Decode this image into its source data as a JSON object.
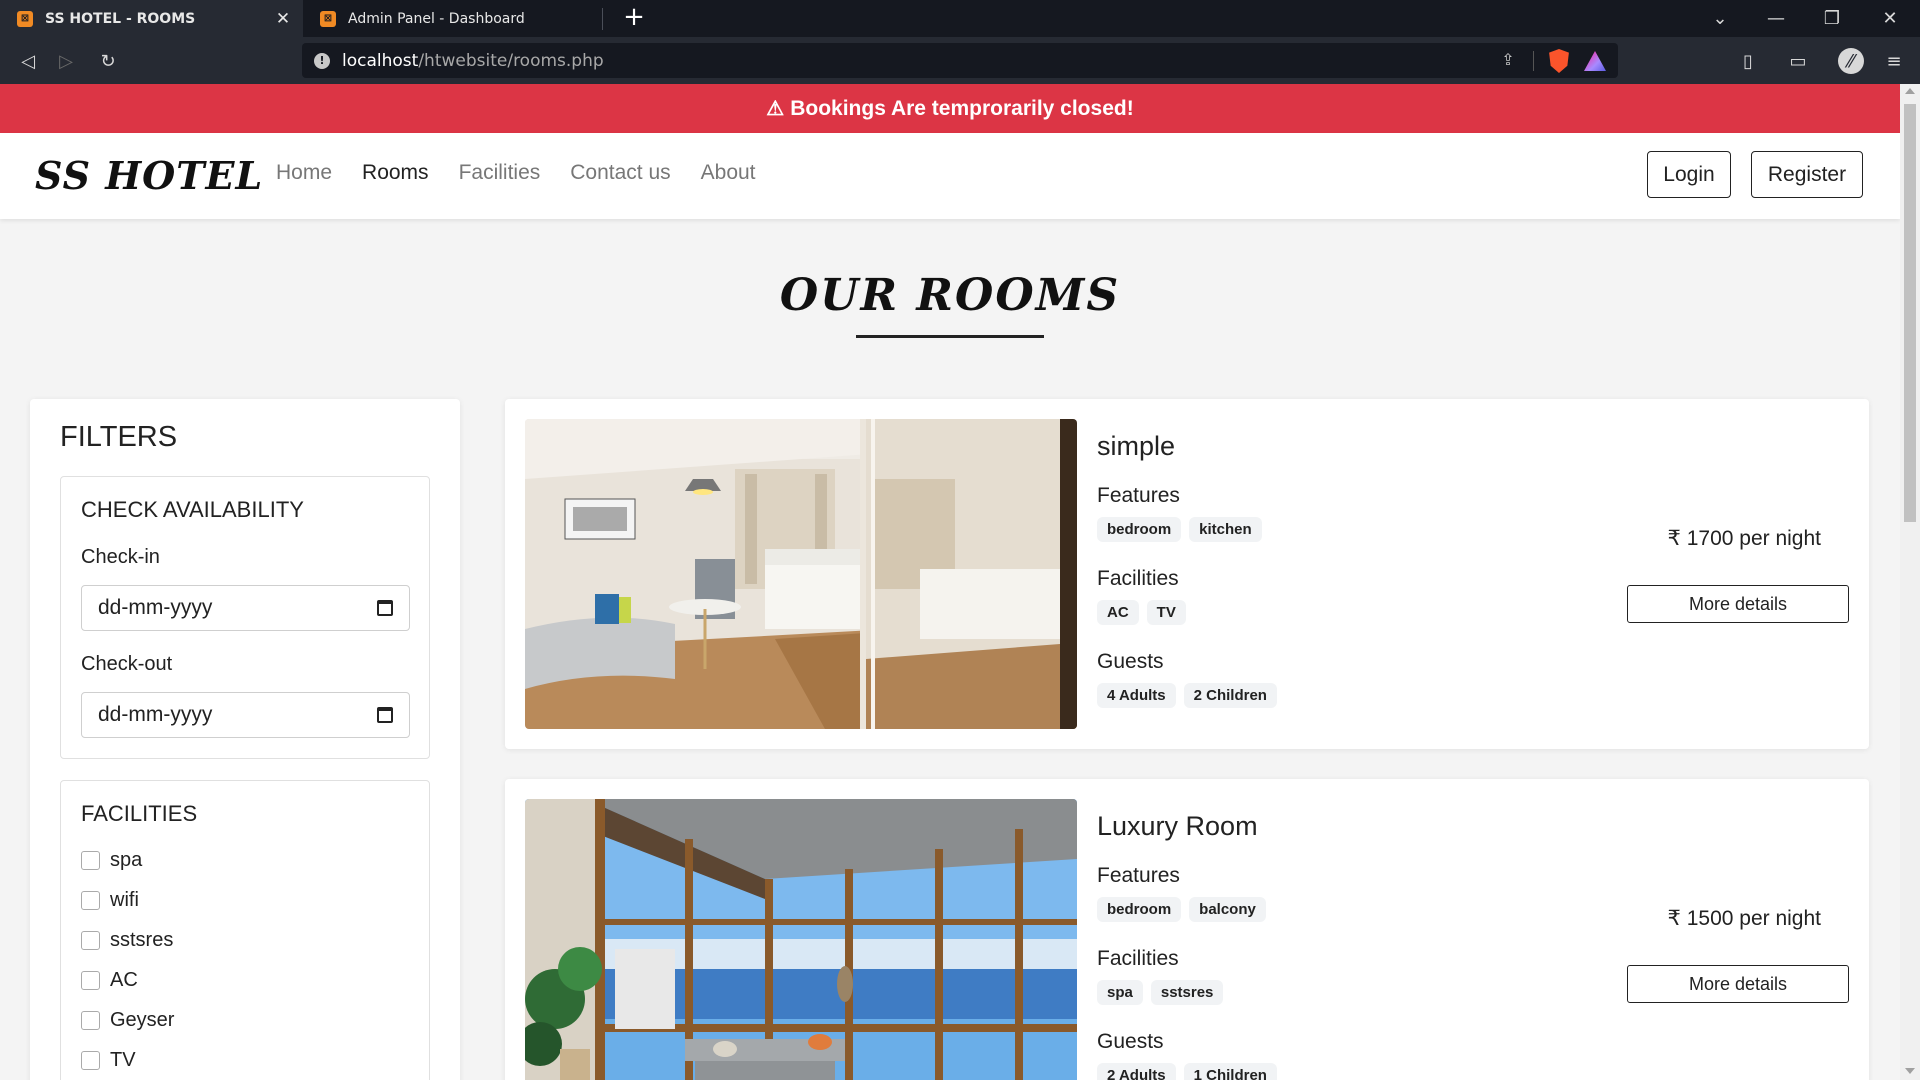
{
  "browser": {
    "tabs": [
      {
        "title": "SS HOTEL - ROOMS",
        "active": true
      },
      {
        "title": "Admin Panel - Dashboard",
        "active": false
      }
    ],
    "url_host": "localhost",
    "url_path": "/htwebsite/rooms.php"
  },
  "alert": {
    "text": "Bookings Are temprorarily closed!"
  },
  "nav": {
    "brand": "SS HOTEL",
    "links": [
      "Home",
      "Rooms",
      "Facilities",
      "Contact us",
      "About"
    ],
    "current": "Rooms",
    "login": "Login",
    "register": "Register"
  },
  "page": {
    "heading": "OUR ROOMS"
  },
  "filters": {
    "title": "FILTERS",
    "availability": {
      "title": "CHECK AVAILABILITY",
      "checkin_label": "Check-in",
      "checkout_label": "Check-out",
      "date_placeholder": "dd-mm-yyyy"
    },
    "facilities": {
      "title": "FACILITIES",
      "options": [
        "spa",
        "wifi",
        "sstsres",
        "AC",
        "Geyser",
        "TV"
      ]
    }
  },
  "rooms": [
    {
      "name": "simple",
      "features_label": "Features",
      "features": [
        "bedroom",
        "kitchen"
      ],
      "facilities_label": "Facilities",
      "facilities": [
        "AC",
        "TV"
      ],
      "guests_label": "Guests",
      "guests": [
        "4 Adults",
        "2 Children"
      ],
      "price": "₹  1700 per night",
      "button": "More details"
    },
    {
      "name": "Luxury Room",
      "features_label": "Features",
      "features": [
        "bedroom",
        "balcony"
      ],
      "facilities_label": "Facilities",
      "facilities": [
        "spa",
        "sstsres"
      ],
      "guests_label": "Guests",
      "guests": [
        "2 Adults",
        "1 Children"
      ],
      "price": "₹  1500 per night",
      "button": "More details"
    }
  ],
  "colors": {
    "alert": "#dc3545",
    "chrome": "#151820"
  }
}
